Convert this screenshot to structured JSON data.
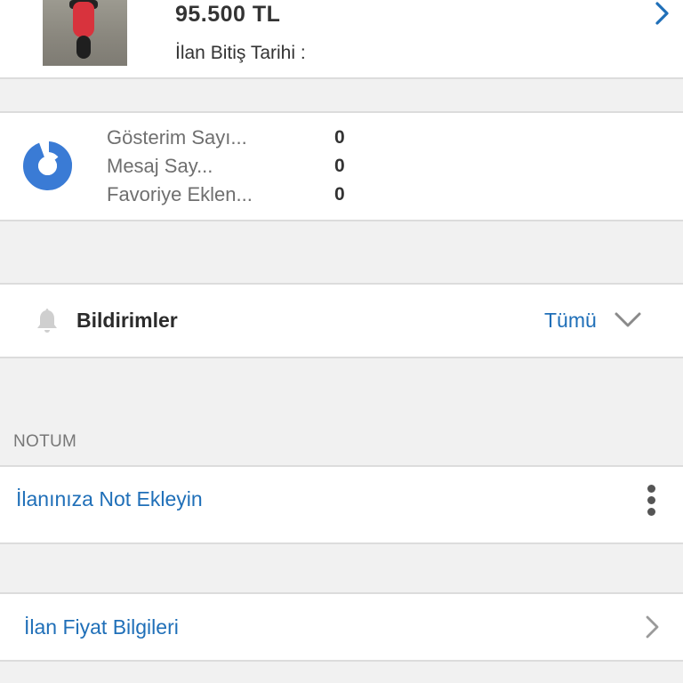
{
  "listing": {
    "price": "95.500 TL",
    "end_date_label": "İlan Bitiş Tarihi :"
  },
  "stats": {
    "items": [
      {
        "label": "Gösterim Sayı...",
        "value": "0"
      },
      {
        "label": "Mesaj Say...",
        "value": "0"
      },
      {
        "label": "Favoriye Eklen...",
        "value": "0"
      }
    ]
  },
  "notifications": {
    "title": "Bildirimler",
    "filter": "Tümü"
  },
  "note": {
    "section_header": "NOTUM",
    "add_link": "İlanınıza Not Ekleyin"
  },
  "price_info": {
    "label": "İlan Fiyat Bilgileri"
  },
  "colors": {
    "accent": "#1f6fb8",
    "chart_icon": "#3a7bd5",
    "background": "#f1f1f1"
  },
  "icons": [
    "chevron-right-icon",
    "pie-chart-icon",
    "bell-icon",
    "chevron-down-icon",
    "more-vertical-icon"
  ]
}
